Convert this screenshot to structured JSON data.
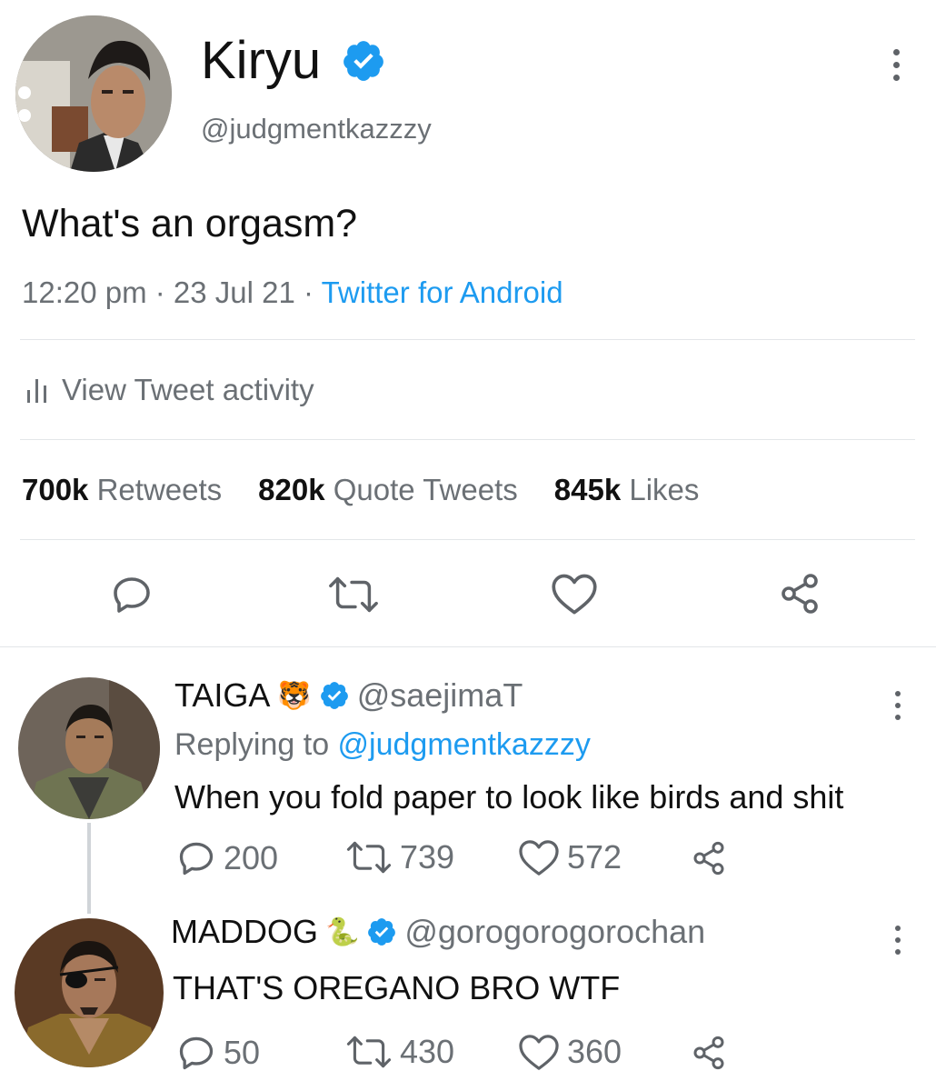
{
  "tweet": {
    "author_name": "Kiryu",
    "author_handle": "@judgmentkazzzy",
    "text": "What's an orgasm?",
    "time": "12:20 pm",
    "sep1": " · ",
    "date": "23 Jul 21",
    "sep2": " · ",
    "source": "Twitter for Android",
    "activity_label": "View Tweet activity",
    "stats": [
      {
        "num": "700k",
        "label": "Retweets"
      },
      {
        "num": "820k",
        "label": "Quote Tweets"
      },
      {
        "num": "845k",
        "label": "Likes"
      }
    ],
    "icons": {
      "reply": "reply-icon",
      "retweet": "retweet-icon",
      "like": "heart-icon",
      "share": "share-icon",
      "activity": "bar-chart-icon",
      "more": "more-vertical-icon"
    }
  },
  "replies": [
    {
      "name": "TAIGA",
      "emoji": "🐯",
      "handle": "@saejimaT",
      "replying_prefix": "Replying to ",
      "replying_to": "@judgmentkazzzy",
      "text": "When you fold paper to look like birds and shit",
      "replies": "200",
      "retweets": "739",
      "likes": "572"
    },
    {
      "name": "MADDOG",
      "emoji": "🐍",
      "handle": "@gorogorogorochan",
      "text": "THAT'S OREGANO BRO WTF",
      "replies": "50",
      "retweets": "430",
      "likes": "360"
    }
  ],
  "colors": {
    "verified": "#1d9bf0",
    "link": "#1d9bf0",
    "secondary_text": "#6b7075",
    "divider": "#e3e6e9"
  }
}
